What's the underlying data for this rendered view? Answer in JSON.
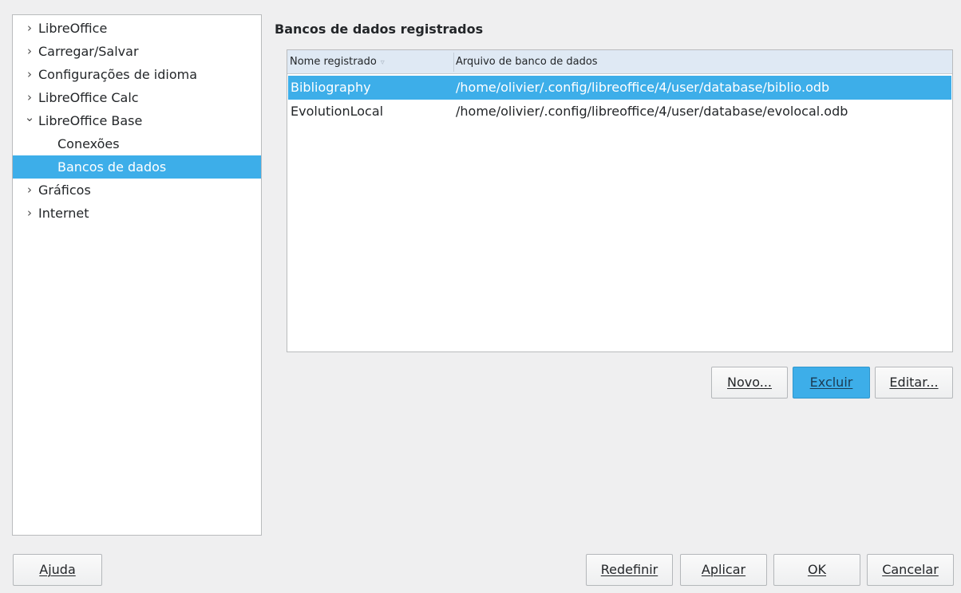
{
  "sidebar": {
    "items": [
      {
        "label": "LibreOffice",
        "expander": "collapsed"
      },
      {
        "label": "Carregar/Salvar",
        "expander": "collapsed"
      },
      {
        "label": "Configurações de idioma",
        "expander": "collapsed"
      },
      {
        "label": "LibreOffice Calc",
        "expander": "collapsed"
      },
      {
        "label": "LibreOffice Base",
        "expander": "expanded"
      },
      {
        "label": "Conexões",
        "expander": "none"
      },
      {
        "label": "Bancos de dados",
        "expander": "none",
        "selected": true
      },
      {
        "label": "Gráficos",
        "expander": "collapsed"
      },
      {
        "label": "Internet",
        "expander": "collapsed"
      }
    ]
  },
  "main": {
    "title": "Bancos de dados registrados",
    "table": {
      "columns": [
        "Nome registrado",
        "Arquivo de banco de dados"
      ],
      "sort_icon": "▿",
      "rows": [
        {
          "name": "Bibliography",
          "file": "/home/olivier/.config/libreoffice/4/user/database/biblio.odb",
          "selected": true
        },
        {
          "name": "EvolutionLocal",
          "file": "/home/olivier/.config/libreoffice/4/user/database/evolocal.odb"
        }
      ]
    },
    "buttons": {
      "new": "Novo...",
      "delete": "Excluir",
      "edit": "Editar..."
    }
  },
  "footer": {
    "help": "Ajuda",
    "reset": "Redefinir",
    "apply": "Aplicar",
    "ok": "OK",
    "cancel": "Cancelar"
  },
  "icons": {
    "collapsed": "›",
    "expanded": "⌄"
  },
  "colors": {
    "selection": "#3daee9",
    "window_bg": "#efeff0",
    "header_bg": "#dfe9f4"
  }
}
